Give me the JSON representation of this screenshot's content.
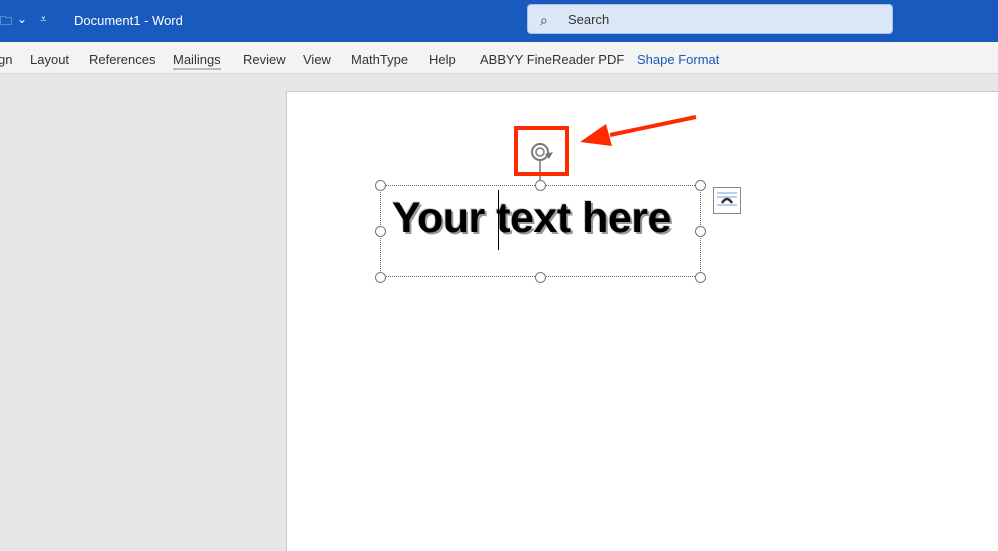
{
  "titlebar": {
    "title": "Document1  -  Word",
    "search_placeholder": "Search"
  },
  "ribbon": {
    "tabs": [
      "gn",
      "Layout",
      "References",
      "Mailings",
      "Review",
      "View",
      "MathType",
      "Help",
      "ABBYY FineReader PDF",
      "Shape Format"
    ]
  },
  "document": {
    "wordart_text": "Your text here"
  },
  "annotation": {
    "color": "#ff2a00"
  }
}
